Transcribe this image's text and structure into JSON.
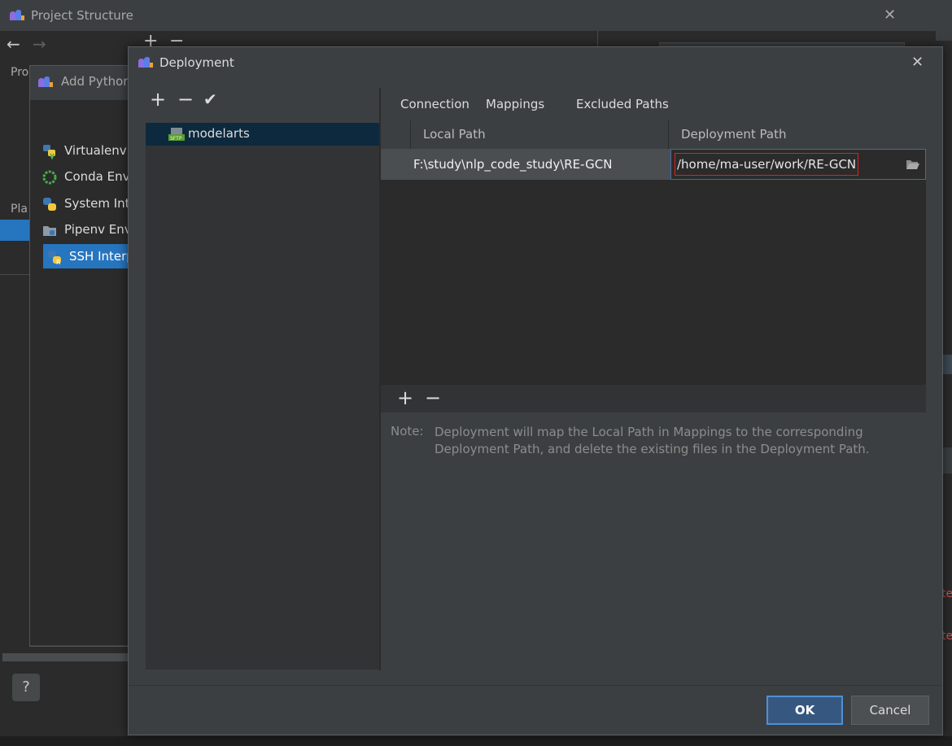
{
  "project_structure": {
    "title": "Project Structure",
    "close_glyph": "✕",
    "nav_back": "←",
    "nav_forward": "→",
    "add_glyph": "+",
    "remove_glyph": "−",
    "left_label_top": "Pro",
    "left_label_mid": "Pla",
    "help_label": "?",
    "right_red_1": "te",
    "right_red_2": "te"
  },
  "add_python_interpreter": {
    "title": "Add Python Interpreter",
    "items": [
      {
        "label": "Virtualenv Environment",
        "icon": "python-virtualenv-icon"
      },
      {
        "label": "Conda Environment",
        "icon": "conda-icon"
      },
      {
        "label": "System Interpreter",
        "icon": "python-icon"
      },
      {
        "label": "Pipenv Environment",
        "icon": "pipenv-icon"
      },
      {
        "label": "SSH Interpreter",
        "icon": "python-remote-icon",
        "selected": true
      }
    ]
  },
  "deployment": {
    "title": "Deployment",
    "close_glyph": "✕",
    "toolbar": {
      "add": "+",
      "remove": "−",
      "check": "✔"
    },
    "servers": [
      {
        "label": "modelarts",
        "icon": "sftp-server-icon"
      }
    ],
    "tabs": [
      {
        "label": "Connection"
      },
      {
        "label": "Mappings",
        "active": true
      },
      {
        "label": "Excluded Paths"
      }
    ],
    "mappings": {
      "columns": {
        "local": "Local Path",
        "deploy": "Deployment Path"
      },
      "rows": [
        {
          "local": "F:\\study\\nlp_code_study\\RE-GCN",
          "deploy": "/home/ma-user/work/RE-GCN"
        }
      ],
      "footer": {
        "add": "+",
        "remove": "−"
      }
    },
    "note": {
      "label": "Note:",
      "text": "Deployment will map the Local Path in Mappings to the corresponding Deployment Path, and delete the existing files in the Deployment Path."
    },
    "buttons": {
      "ok": "OK",
      "cancel": "Cancel"
    }
  }
}
